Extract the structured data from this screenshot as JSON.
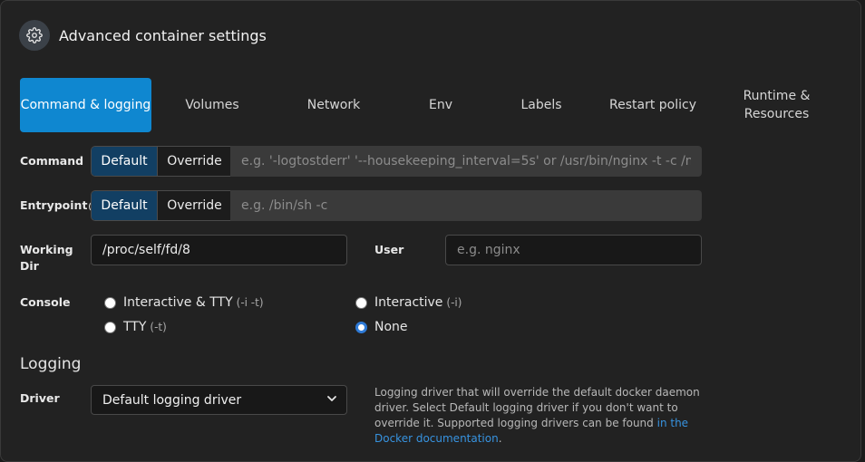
{
  "header": {
    "icon": "gear-icon",
    "title": "Advanced container settings"
  },
  "tabs": [
    {
      "label": "Command & logging",
      "active": true
    },
    {
      "label": "Volumes",
      "active": false
    },
    {
      "label": "Network",
      "active": false
    },
    {
      "label": "Env",
      "active": false
    },
    {
      "label": "Labels",
      "active": false
    },
    {
      "label": "Restart policy",
      "active": false
    },
    {
      "label": "Runtime & Resources",
      "active": false
    }
  ],
  "command": {
    "label": "Command",
    "default_label": "Default",
    "override_label": "Override",
    "placeholder": "e.g. '-logtostderr' '--housekeeping_interval=5s' or /usr/bin/nginx -t -c /mynginx.conf"
  },
  "entrypoint": {
    "label": "Entrypoint",
    "help_icon": "question-circle-icon",
    "default_label": "Default",
    "override_label": "Override",
    "placeholder": "e.g. /bin/sh -c"
  },
  "working_dir": {
    "label_line1": "Working",
    "label_line2": "Dir",
    "value": "/proc/self/fd/8"
  },
  "user": {
    "label": "User",
    "placeholder": "e.g. nginx"
  },
  "console": {
    "label": "Console",
    "options": {
      "interactive_tty": {
        "label": "Interactive & TTY",
        "flag": "(-i -t)",
        "checked": false
      },
      "interactive": {
        "label": "Interactive",
        "flag": "(-i)",
        "checked": false
      },
      "tty": {
        "label": "TTY",
        "flag": "(-t)",
        "checked": false
      },
      "none": {
        "label": "None",
        "checked": true
      }
    }
  },
  "logging": {
    "section_title": "Logging",
    "driver_label": "Driver",
    "driver_value": "Default logging driver",
    "help_text": "Logging driver that will override the default docker daemon driver. Select Default logging driver if you don't want to override it. Supported logging drivers can be found ",
    "help_link_text": "in the Docker documentation",
    "help_end": ".",
    "accent": "#0f87d0",
    "link_color": "#3793e0"
  }
}
